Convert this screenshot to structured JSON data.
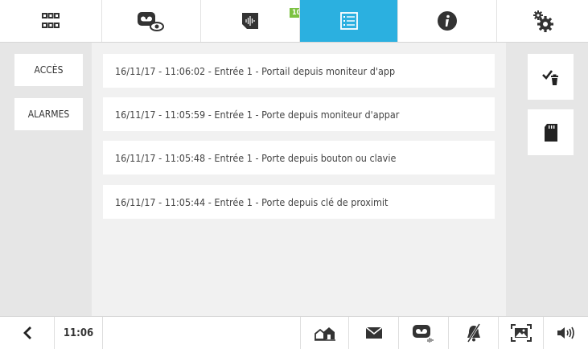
{
  "top_bar": {
    "tabs": [
      {
        "icon": "grid-icon"
      },
      {
        "icon": "video-memory-icon",
        "badge": "10"
      },
      {
        "icon": "audio-message-icon"
      },
      {
        "icon": "event-list-icon",
        "active": true
      },
      {
        "icon": "info-icon"
      },
      {
        "icon": "settings-gears-icon"
      }
    ],
    "active_color": "#2bb0e0",
    "badge_color": "#7cc242"
  },
  "left_menu": {
    "items": [
      {
        "label": "ACCÈS"
      },
      {
        "label": "ALARMES"
      }
    ]
  },
  "events": [
    "16/11/17 - 11:06:02 - Entrée 1 - Portail depuis moniteur d'app",
    "16/11/17 - 11:05:59 - Entrée 1 - Porte depuis moniteur d'appar",
    "16/11/17 - 11:05:48 - Entrée 1 - Porte depuis bouton ou clavie",
    "16/11/17 - 11:05:44 - Entrée 1 - Porte depuis clé de proximit"
  ],
  "right_actions": [
    {
      "icon": "check-delete-icon"
    },
    {
      "icon": "sd-card-icon"
    }
  ],
  "bottom_bar": {
    "time": "11:06",
    "icons": [
      "back-chevron-icon",
      "house-icon",
      "mail-icon",
      "video-audio-icon",
      "mute-bell-icon",
      "picture-frame-icon",
      "speaker-icon"
    ]
  }
}
